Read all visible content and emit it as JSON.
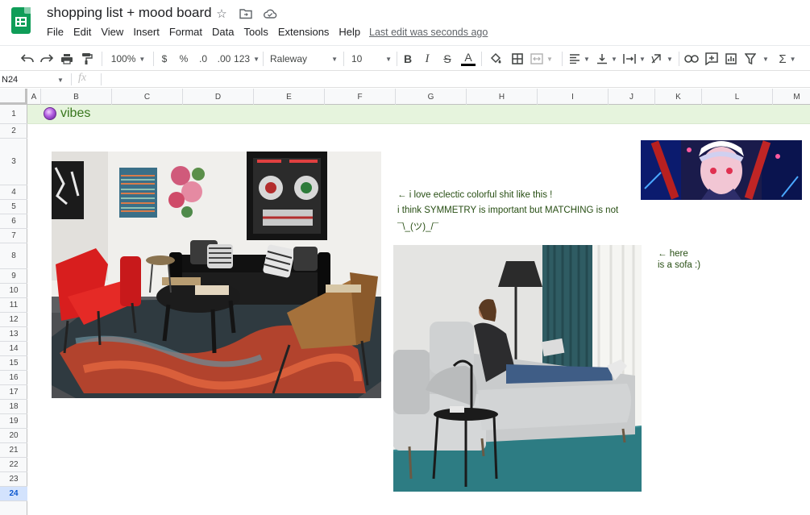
{
  "app": {
    "doc_title": "shopping list + mood board",
    "menu": [
      "File",
      "Edit",
      "View",
      "Insert",
      "Format",
      "Data",
      "Tools",
      "Extensions",
      "Help"
    ],
    "last_edit": "Last edit was seconds ago"
  },
  "toolbar": {
    "zoom": "100%",
    "currency": "$",
    "percent": "%",
    "dec_decrease": ".0",
    "dec_increase": ".00",
    "number_format": "123",
    "font": "Raleway",
    "font_size": "10",
    "bold": "B",
    "italic": "I",
    "strike": "S",
    "font_color": "A",
    "sum": "Σ"
  },
  "formula_bar": {
    "name_box": "N24",
    "fx": "fx",
    "value": ""
  },
  "grid": {
    "columns": [
      "A",
      "B",
      "C",
      "D",
      "E",
      "F",
      "G",
      "H",
      "I",
      "J",
      "K",
      "L",
      "M"
    ],
    "rows": [
      "1",
      "2",
      "3",
      "4",
      "5",
      "6",
      "7",
      "8",
      "9",
      "10",
      "11",
      "12",
      "13",
      "14",
      "15",
      "16",
      "17",
      "18",
      "19",
      "20",
      "21",
      "22",
      "23",
      "24"
    ],
    "selected_row": "24"
  },
  "content": {
    "header": "vibes",
    "note_eclectic": "← i love eclectic colorful shit like this !",
    "note_symmetry": "i think SYMMETRY is important but MATCHING is not",
    "note_shrug": "¯\\_(ツ)_/¯",
    "note_here": "←  here",
    "note_sofa": "is a sofa :)"
  },
  "colors": {
    "header_band": "#e6f4dd",
    "header_text": "#38761d",
    "note_text": "#274e13",
    "sheets_green": "#0f9d58"
  }
}
